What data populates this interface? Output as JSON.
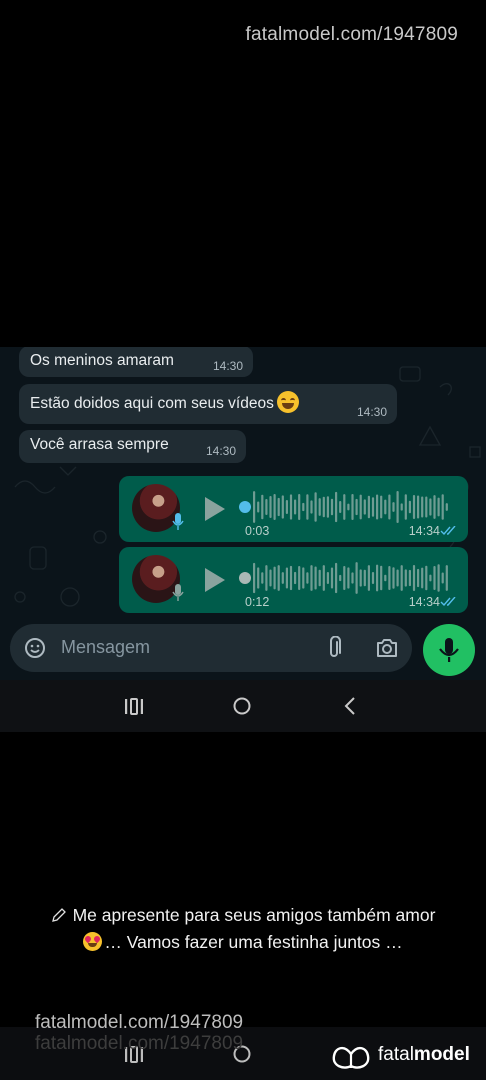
{
  "watermark": {
    "top": "fatalmodel.com/1947809",
    "bottom": "fatalmodel.com/1947809"
  },
  "chat": {
    "incoming": [
      {
        "text": "Os meninos amaram",
        "time": "14:30"
      },
      {
        "text": "Estão doidos aqui com seus vídeos",
        "emoji": "face-with-tears-of-joy",
        "time": "14:30"
      },
      {
        "text": "Você arrasa sempre",
        "time": "14:30"
      }
    ],
    "audio_messages": [
      {
        "duration": "0:03",
        "time": "14:34",
        "status": "read",
        "progress": 0.0
      },
      {
        "duration": "0:12",
        "time": "14:34",
        "status": "read",
        "progress": 0.0
      }
    ],
    "composer": {
      "placeholder": "Mensagem"
    },
    "colors": {
      "background": "#0b141a",
      "incoming_bubble": "#202c33",
      "outgoing_bubble": "#005c4b",
      "send_button": "#21c063",
      "read_ticks": "#53bdeb"
    }
  },
  "nav_icons": [
    "recent-apps-icon",
    "home-icon",
    "back-icon"
  ],
  "caption": {
    "line1": "Me apresente para seus amigos também amor",
    "line2": "… Vamos fazer uma festinha juntos …"
  },
  "brand": {
    "light": "fatal",
    "bold": "model"
  }
}
